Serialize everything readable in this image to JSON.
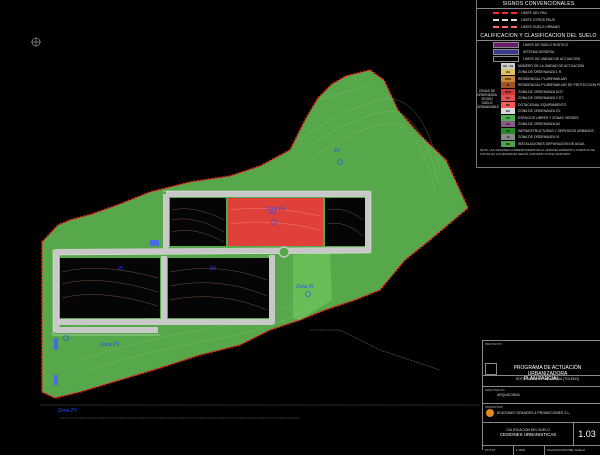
{
  "legend": {
    "title_signs": "SIGNOS CONVENCIONALES",
    "signs": [
      {
        "label": "LIMITE DEL PAU",
        "color": "#ff2a2a"
      },
      {
        "label": "LIMITE OTROS PAUS",
        "color": "#dddddd"
      },
      {
        "label": "LIMITE SUELO URBANO",
        "color": "#ff6a6a"
      }
    ],
    "title_calif": "CALIFICACION Y CLASIFICACION DEL SUELO",
    "classes": [
      {
        "label": "LÍMITE DE SUELO RÚSTICO",
        "color": "#6a1a6a"
      },
      {
        "label": "SISTEMA GENERAL",
        "color": "#3a3a8a"
      },
      {
        "label": "LÍMITE DE UNIDAD DE ACTUACIÓN",
        "color": "#000000"
      }
    ],
    "ua_code": "UA · 01",
    "ua_caption": "NÚMERO DE LA UNIDAD DE ACTUACIÓN",
    "zones_caption": "ZONAS DE ORDENANZA SEGÚN SUELO URBANIZABLE",
    "zones": [
      {
        "code": "UA",
        "label": "ZONA DE ORDENANZA 1 R.",
        "color": "#e0c060"
      },
      {
        "code": "APU",
        "label": "RESIDENCIAL PLURIFAMILIAR",
        "color": "#c88a3a"
      },
      {
        "code": "R",
        "label": "RESIDENCIAL PLURIFAMILIAR DE PROTECCIÓN PÚBLICA",
        "color": "#a0522d"
      },
      {
        "code": "DOT",
        "label": "ZONA DE ORDENANZA DOT.",
        "color": "#cc3a3a"
      },
      {
        "code": "DT",
        "label": "ZONA DE ORDENANZA 2 DT.",
        "color": "#e05050"
      },
      {
        "code": "DE",
        "label": "DOTACIONAL EQUIPAMIENTO",
        "color": "#ff5a5a"
      },
      {
        "code": "EZ",
        "label": "ZONA DE ORDENANZA ZV.",
        "color": "#d8d8d8"
      },
      {
        "code": "ZV",
        "label": "ESPACIOS LIBRES Y ZONAS VERDES",
        "color": "#4caf50"
      },
      {
        "code": "AV",
        "label": "ZONA DE ORDENANZA AV.",
        "color": "#8a5a8a"
      },
      {
        "code": "IN",
        "label": "INFRAESTRUCTURAS Y SERVICIOS URBANOS",
        "color": "#2a8a2a"
      },
      {
        "code": "VI",
        "label": "ZONA DE ORDENANZA VI.",
        "color": "#8a8a8a"
      },
      {
        "code": "DE",
        "label": "INSTALACIONES DEPURACIÓN DE AGUA",
        "color": "#50a050"
      }
    ],
    "note": "NOTA: LAS CESIONES CORRESPONDIENTES AL APROVECHAMIENTO LUCRATIVO SE SITÚAN EN LAS MANZANAS SEGÚN CONVENIO CON EL MUNICIPIO."
  },
  "map": {
    "labels": [
      {
        "text": "EZ",
        "kind": "zone"
      },
      {
        "text": "ZV",
        "kind": "zone"
      },
      {
        "text": "VI",
        "kind": "zone"
      },
      {
        "text": "ZV",
        "kind": "zone"
      },
      {
        "text": "Zona ZV",
        "kind": "zone"
      },
      {
        "text": "Zona DE",
        "kind": "zone"
      },
      {
        "text": "Zona VI",
        "kind": "zone"
      },
      {
        "text": "Zona ZV",
        "kind": "zone"
      }
    ]
  },
  "title_block": {
    "project_small": "PROYECTO",
    "project_1": "PROGRAMA DE ACTUACIÓN URBANIZADORA",
    "project_2": "SOTO ROMERO · MENTRIDA (TOLEDO)",
    "phase": "PLAN PARCIAL",
    "architect_small": "ARQUITECTO",
    "architect": "ARQUICONSA",
    "promoter_small": "PROMOTOR",
    "promoter": "EDICIONES GRANDES & PROMOCIONES S.L.",
    "plan_1": "CALIFICACION DEL SUELO",
    "plan_2": "CESIONES URBANISTICAS",
    "date": "OCT-07",
    "scale": "1:1000",
    "plan_code": "1.03"
  },
  "colors": {
    "parcel_green": "#57a84a",
    "parcel_light": "#6abf59",
    "road": "#c8c8c8",
    "boundary": "#ff1a1a",
    "equipment": "#e0403a",
    "contour": "#c08a7a"
  }
}
